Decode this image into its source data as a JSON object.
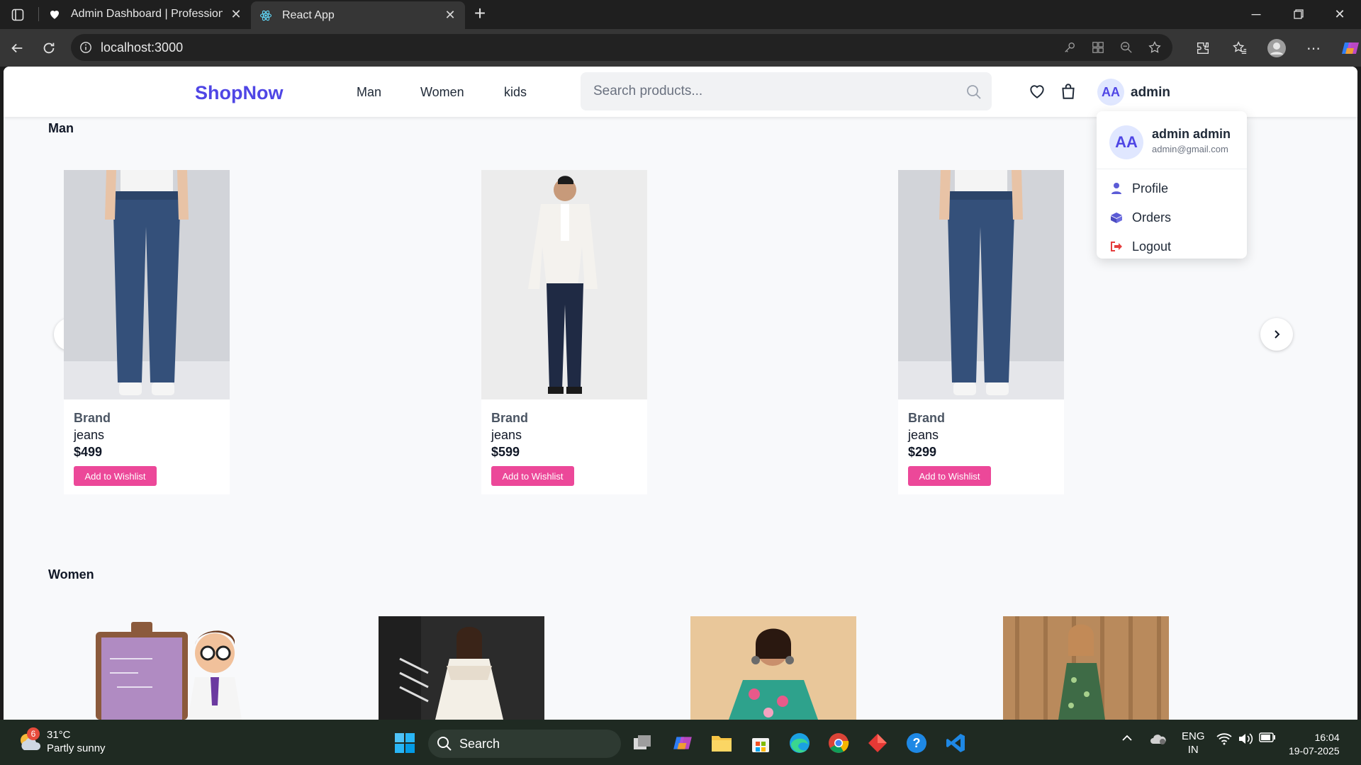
{
  "browser": {
    "tabs": [
      {
        "title": "Admin Dashboard | Professional M",
        "favicon": "heart-icon",
        "active": false
      },
      {
        "title": "React App",
        "favicon": "react-icon",
        "active": true
      }
    ],
    "url": "localhost:3000"
  },
  "site": {
    "logo": "ShopNow",
    "nav": [
      "Man",
      "Women",
      "kids"
    ],
    "search_placeholder": "Search products...",
    "user": {
      "initials": "AA",
      "short_name": "admin"
    },
    "brand_color": "#4f46e5",
    "accent_color": "#ec4899"
  },
  "dropdown": {
    "name": "admin admin",
    "email": "admin@gmail.com",
    "items": [
      {
        "label": "Profile",
        "icon": "user-icon"
      },
      {
        "label": "Orders",
        "icon": "box-icon"
      },
      {
        "label": "Logout",
        "icon": "logout-icon"
      }
    ]
  },
  "sections": {
    "man": {
      "title": "Man",
      "products": [
        {
          "brand": "Brand",
          "name": "jeans",
          "price": "$499",
          "button": "Add to Wishlist"
        },
        {
          "brand": "Brand",
          "name": "jeans",
          "price": "$599",
          "button": "Add to Wishlist"
        },
        {
          "brand": "Brand",
          "name": "jeans",
          "price": "$299",
          "button": "Add to Wishlist"
        }
      ]
    },
    "women": {
      "title": "Women"
    }
  },
  "taskbar": {
    "weather_badge": "6",
    "temperature": "31°C",
    "condition": "Partly sunny",
    "search_label": "Search",
    "lang_line1": "ENG",
    "lang_line2": "IN",
    "time": "16:04",
    "date": "19-07-2025"
  }
}
